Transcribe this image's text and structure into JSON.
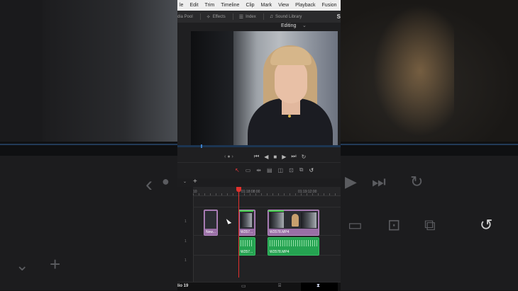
{
  "menu": [
    "le",
    "Edit",
    "Trim",
    "Timeline",
    "Clip",
    "Mark",
    "View",
    "Playback",
    "Fusion"
  ],
  "toolbar": {
    "media_pool": "dia Pool",
    "effects": "Effects",
    "index": "Index",
    "sound_library": "Sound Library",
    "right_letter": "S"
  },
  "viewer": {
    "mode": "Editing",
    "mode_chevron": "⌄"
  },
  "timeline": {
    "timecodes": [
      "10",
      "01:18:08:00",
      "01:19:12:00"
    ],
    "track_labels": [
      "1",
      "1",
      "1"
    ],
    "clips": {
      "v_small": "New...",
      "v_mid": "W257...",
      "v_main": "W2578.MP4",
      "a_mid": "W257...",
      "a_main": "W2578.MP4"
    }
  },
  "bottom": {
    "brand": "lio 19"
  },
  "icons": {
    "transport": [
      "⏮",
      "◀",
      "■",
      "▶",
      "⏭",
      "↻"
    ],
    "tools": [
      "↖",
      "▭",
      "⇹",
      "▤",
      "◫",
      "⊡",
      "⧉",
      "↺"
    ]
  }
}
